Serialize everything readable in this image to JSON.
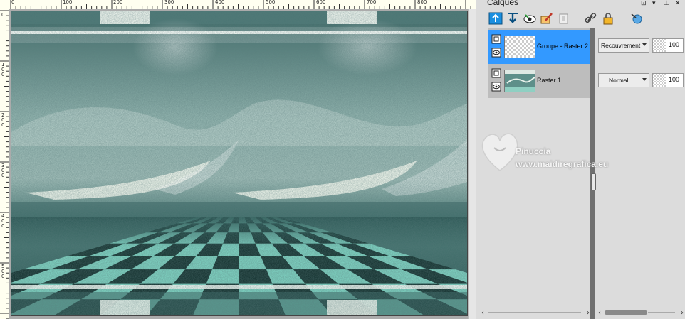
{
  "ruler_top": {
    "labels": [
      "0",
      "100",
      "200",
      "300",
      "400",
      "500",
      "600",
      "700",
      "800"
    ]
  },
  "ruler_left": {
    "labels": [
      "0",
      "1\n0\n0",
      "2\n0\n0",
      "3\n0\n0",
      "4\n0\n0",
      "5\n0\n0"
    ]
  },
  "panel": {
    "title": "Calques",
    "controls": [
      "⊡",
      "▾",
      "⊥",
      "✕"
    ]
  },
  "toolbar": {
    "icons": [
      "new-raster-layer-icon",
      "new-vector-layer-icon",
      "new-mask-layer-icon",
      "new-adjustment-layer-icon",
      "duplicate-layer-icon",
      "link-icon",
      "lock-icon",
      "layer-properties-icon"
    ]
  },
  "layers": [
    {
      "name": "Groupe - Raster 2",
      "blend_mode": "Recouvrement",
      "opacity": "100",
      "selected": true
    },
    {
      "name": "Raster 1",
      "blend_mode": "Normal",
      "opacity": "100",
      "selected": false
    }
  ],
  "watermark": {
    "line1": "Pinuccia",
    "line2": "www.maidiregrafica.eu"
  },
  "colors": {
    "selection": "#3399ff",
    "teal_dark": "#2f5a58",
    "teal_light": "#a9d6d0",
    "checker_mint": "#7fd3c2"
  }
}
